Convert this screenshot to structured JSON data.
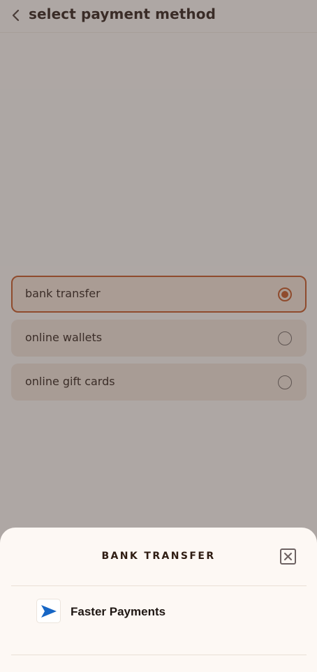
{
  "header": {
    "title": "select payment method"
  },
  "payment_options": [
    {
      "label": "bank transfer",
      "selected": true
    },
    {
      "label": "online wallets",
      "selected": false
    },
    {
      "label": "online gift cards",
      "selected": false
    }
  ],
  "sheet": {
    "title": "BANK TRANSFER",
    "methods": [
      {
        "label": "Faster Payments",
        "icon": "faster-payments-arrow-icon"
      }
    ]
  },
  "colors": {
    "accent": "#c4531d",
    "background": "#fbf6f1",
    "option_bg": "#f0e2d6",
    "text": "#2e1c12",
    "overlay": "rgba(74,66,66,0.44)",
    "logo_blue": "#1666c5"
  }
}
